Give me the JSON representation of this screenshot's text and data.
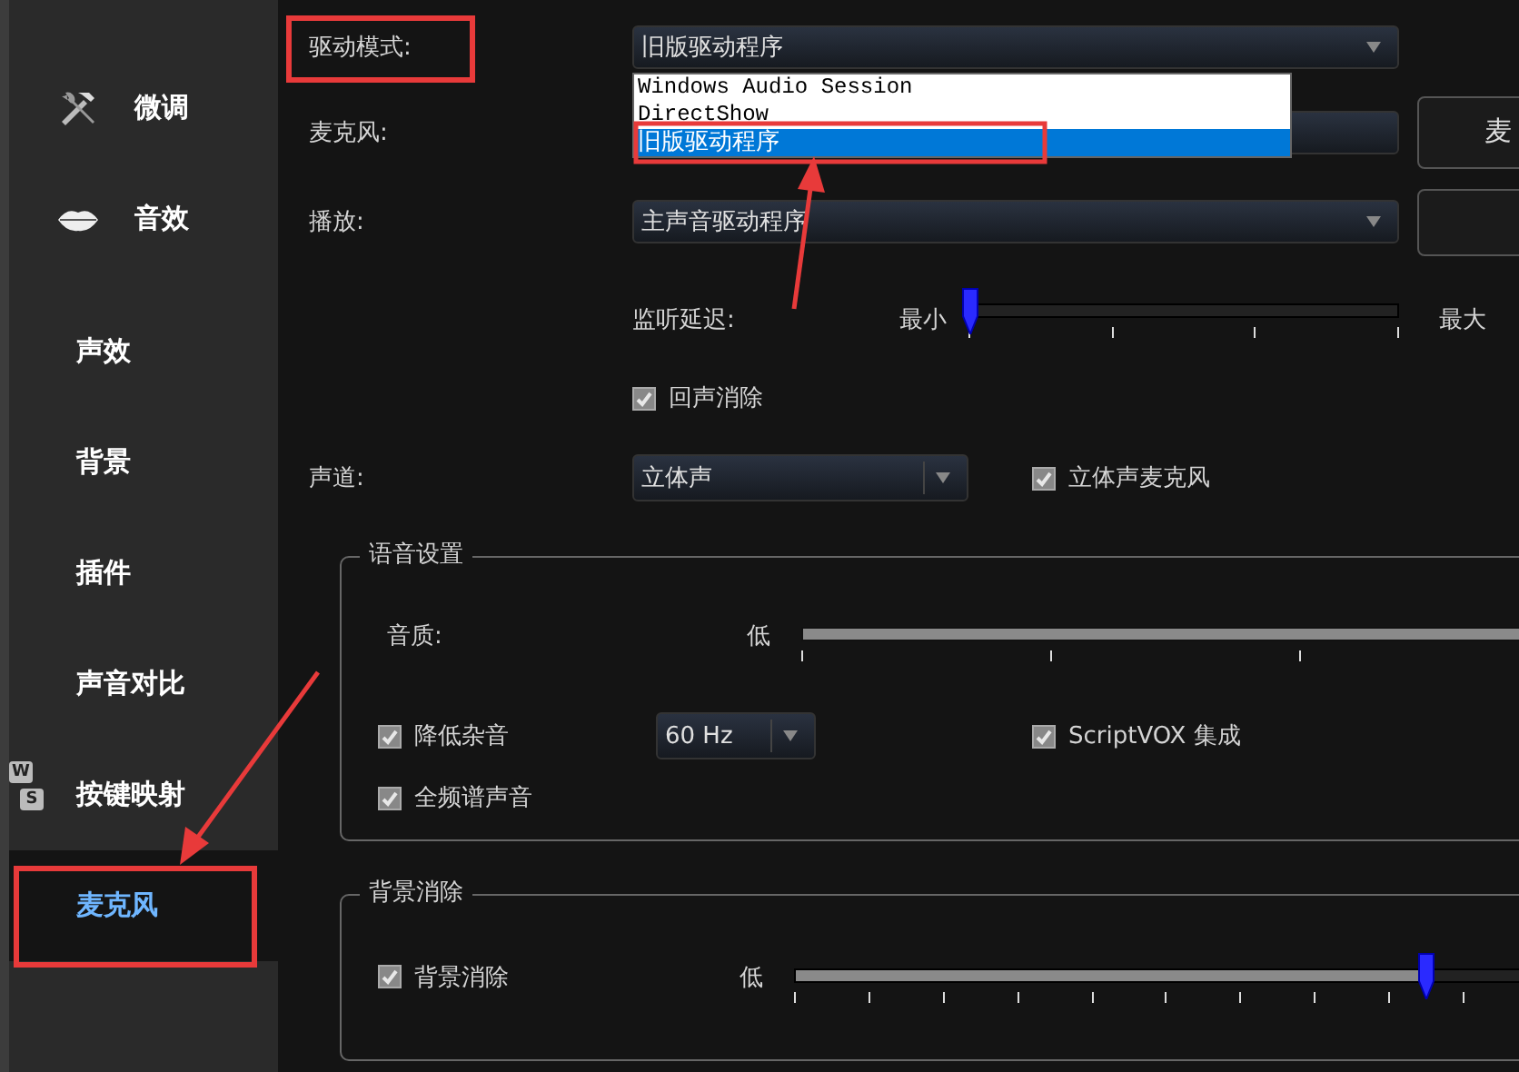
{
  "sidebar": {
    "main_items": [
      {
        "label": "微调",
        "kind": "tools",
        "selected": false
      },
      {
        "label": "音效",
        "kind": "lips",
        "selected": false
      }
    ],
    "sub_items": [
      {
        "label": "声效",
        "selected": false
      },
      {
        "label": "背景",
        "selected": false
      },
      {
        "label": "插件",
        "selected": false
      },
      {
        "label": "声音对比",
        "selected": false
      },
      {
        "label": "按键映射",
        "keys": [
          "W",
          "S"
        ],
        "selected": false
      },
      {
        "label": "麦克风",
        "selected": true
      }
    ]
  },
  "settings": {
    "driver_mode": {
      "label": "驱动模式:",
      "value": "旧版驱动程序",
      "options": [
        {
          "label": "Windows Audio Session",
          "selected": false
        },
        {
          "label": "DirectShow",
          "selected": false
        },
        {
          "label": "旧版驱动程序",
          "selected": true
        }
      ]
    },
    "microphone": {
      "label": "麦克风:",
      "button": "麦"
    },
    "playback": {
      "label": "播放:",
      "value": "主声音驱动程序"
    },
    "monitor_latency": {
      "label": "监听延迟:",
      "min": "最小",
      "max": "最大",
      "level": 0
    },
    "echo_cancel": {
      "label": "回声消除",
      "checked": true
    },
    "channel": {
      "label": "声道:",
      "value": "立体声"
    },
    "stereo_mic": {
      "label": "立体声麦克风",
      "checked": true
    }
  },
  "voice_settings": {
    "title": "语音设置",
    "quality": {
      "label": "音质:",
      "min": "低",
      "level": 1
    },
    "noise_reduction": {
      "label": "降低杂音",
      "checked": true
    },
    "frequency": {
      "value": "60 Hz"
    },
    "scriptvox": {
      "label": "ScriptVOX 集成",
      "checked": true
    },
    "full_spectrum": {
      "label": "全频谱声音",
      "checked": true
    }
  },
  "background_removal": {
    "title": "背景消除",
    "checkbox": {
      "label": "背景消除",
      "checked": true
    },
    "min": "低",
    "level": 0.85
  }
}
